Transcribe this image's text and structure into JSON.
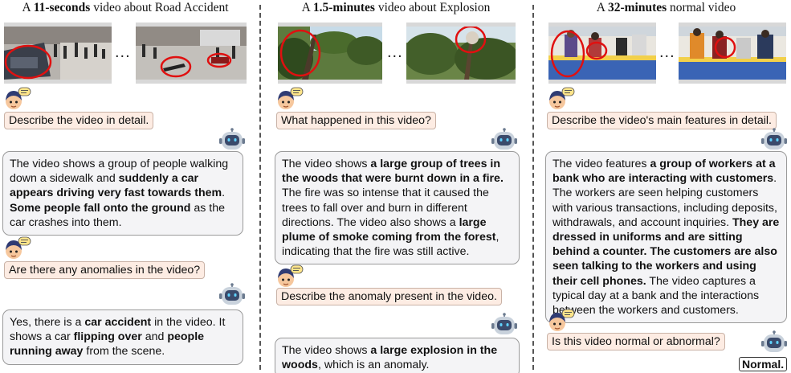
{
  "columns": [
    {
      "title_pre": "A ",
      "title_bold": "11-seconds",
      "title_post": " video about Road Accident",
      "conversation": [
        {
          "question": "Describe the video in detail.",
          "answer": [
            {
              "t": "The video shows a group of people walking down a sidewalk and ",
              "b": false
            },
            {
              "t": "suddenly a car appears driving very fast towards them",
              "b": true
            },
            {
              "t": ". ",
              "b": false
            },
            {
              "t": "Some people fall onto the ground",
              "b": true
            },
            {
              "t": " as the car crashes into them.",
              "b": false
            }
          ]
        },
        {
          "question": "Are there any anomalies in the video?",
          "answer": [
            {
              "t": "Yes, there is a ",
              "b": false
            },
            {
              "t": "car accident",
              "b": true
            },
            {
              "t": " in the video. It shows a car ",
              "b": false
            },
            {
              "t": "flipping over",
              "b": true
            },
            {
              "t": " and ",
              "b": false
            },
            {
              "t": "people running away",
              "b": true
            },
            {
              "t": " from the scene.",
              "b": false
            }
          ]
        }
      ]
    },
    {
      "title_pre": "A ",
      "title_bold": "1.5-minutes",
      "title_post": " video about Explosion",
      "conversation": [
        {
          "question": "What happened in this video?",
          "answer": [
            {
              "t": "The video shows ",
              "b": false
            },
            {
              "t": "a large group of trees in the woods that were burnt down in a fire.",
              "b": true
            },
            {
              "t": " The fire was so intense that it caused the trees to fall over and burn in different directions. The video also shows a ",
              "b": false
            },
            {
              "t": "large plume of smoke coming from the forest",
              "b": true
            },
            {
              "t": ", indicating that the fire was still active.",
              "b": false
            }
          ]
        },
        {
          "question": "Describe the anomaly present in the video.",
          "answer": [
            {
              "t": "The video shows ",
              "b": false
            },
            {
              "t": "a large explosion in the woods",
              "b": true
            },
            {
              "t": ", which is an anomaly.",
              "b": false
            }
          ]
        }
      ]
    },
    {
      "title_pre": "A ",
      "title_bold": "32-minutes",
      "title_post": " normal video",
      "conversation": [
        {
          "question": "Describe the video's main features in detail.",
          "answer": [
            {
              "t": "The video features ",
              "b": false
            },
            {
              "t": "a group of workers at a bank who are interacting with customers",
              "b": true
            },
            {
              "t": ". The workers are seen helping customers with various transactions, including deposits, withdrawals, and account inquiries. ",
              "b": false
            },
            {
              "t": "They are dressed in uniforms and are sitting behind a counter. The customers are also seen talking to the workers and using their cell phones.",
              "b": true
            },
            {
              "t": " The video captures a typical day at a bank and the interactions between the workers and customers.",
              "b": false
            }
          ]
        },
        {
          "question": "Is this video normal or abnormal?",
          "answer_short": "Normal."
        }
      ]
    }
  ],
  "ellipsis": "...",
  "icons": {
    "user": "user-avatar-icon",
    "bot": "robot-assistant-icon"
  },
  "colors": {
    "question_bg": "#fdece3",
    "answer_bg": "#f4f4f6",
    "highlight_circle": "#e01010"
  }
}
